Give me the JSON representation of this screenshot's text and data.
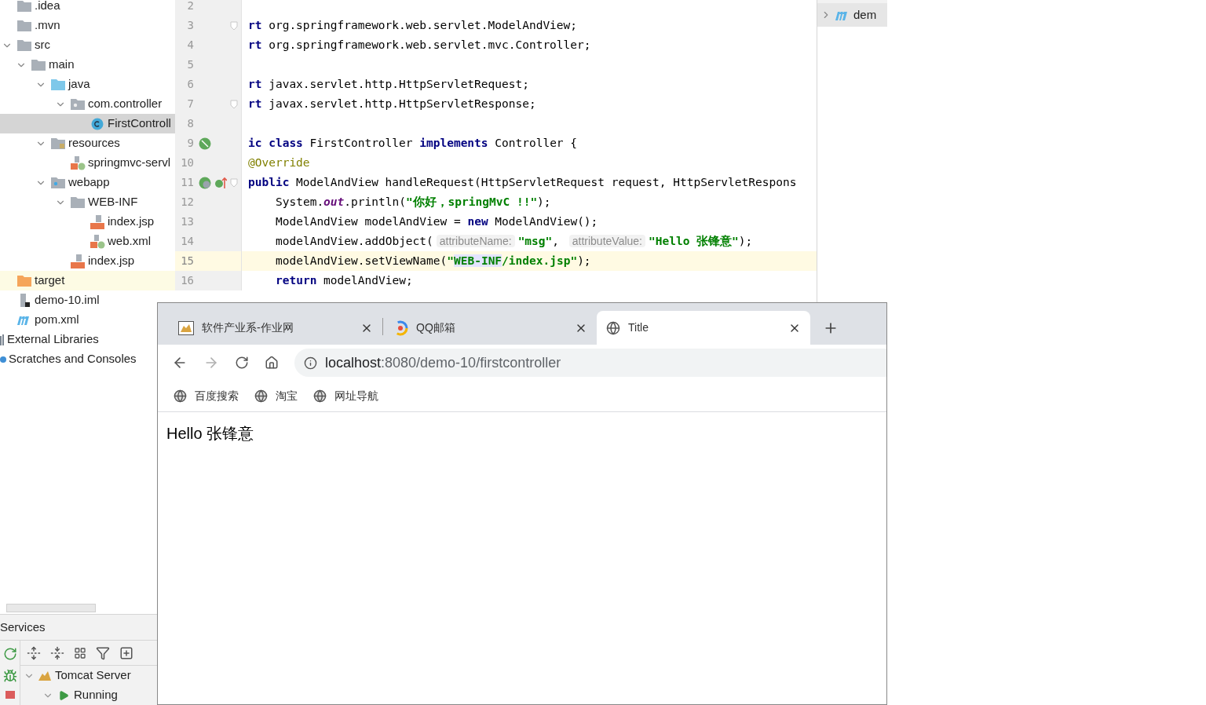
{
  "project_tree": {
    "items": [
      {
        "label": ".idea",
        "kind": "folder",
        "selected": false
      },
      {
        "label": ".mvn",
        "kind": "folder",
        "selected": false
      },
      {
        "label": "src",
        "kind": "folder",
        "selected": false,
        "expanded": true,
        "children": [
          {
            "label": "main",
            "kind": "folder",
            "selected": false,
            "expanded": true,
            "children": [
              {
                "label": "java",
                "kind": "source-folder",
                "selected": false,
                "expanded": true,
                "children": [
                  {
                    "label": "com.controller",
                    "kind": "package",
                    "selected": false,
                    "expanded": true,
                    "children": [
                      {
                        "label": "FirstControll",
                        "kind": "class",
                        "selected": true
                      }
                    ]
                  }
                ]
              },
              {
                "label": "resources",
                "kind": "resources-folder",
                "selected": false,
                "expanded": true,
                "children": [
                  {
                    "label": "springmvc-servl",
                    "kind": "xml",
                    "selected": false
                  }
                ]
              },
              {
                "label": "webapp",
                "kind": "web-folder",
                "selected": false,
                "expanded": true,
                "children": [
                  {
                    "label": "WEB-INF",
                    "kind": "folder",
                    "selected": false,
                    "expanded": true,
                    "children": [
                      {
                        "label": "index.jsp",
                        "kind": "jsp",
                        "selected": false
                      },
                      {
                        "label": "web.xml",
                        "kind": "xml",
                        "selected": false
                      }
                    ]
                  },
                  {
                    "label": "index.jsp",
                    "kind": "jsp",
                    "selected": false
                  }
                ]
              }
            ]
          }
        ]
      },
      {
        "label": "target",
        "kind": "excluded-folder",
        "selected": false
      },
      {
        "label": "demo-10.iml",
        "kind": "iml",
        "selected": false
      },
      {
        "label": "pom.xml",
        "kind": "maven",
        "selected": false
      }
    ],
    "roots": [
      {
        "label": "External Libraries",
        "kind": "libraries"
      },
      {
        "label": "Scratches and Consoles",
        "kind": "scratches"
      }
    ]
  },
  "editor": {
    "lines": [
      {
        "number": "2",
        "selected": false
      },
      {
        "number": "3",
        "selected": false,
        "fold": true,
        "segments": [
          {
            "kind": "keyword",
            "text": "rt"
          },
          {
            "kind": "plain",
            "text": " org.springframework.web.servlet.ModelAndView;"
          }
        ]
      },
      {
        "number": "4",
        "selected": false,
        "segments": [
          {
            "kind": "keyword",
            "text": "rt"
          },
          {
            "kind": "plain",
            "text": " org.springframework.web.servlet.mvc.Controller;"
          }
        ]
      },
      {
        "number": "5",
        "selected": false
      },
      {
        "number": "6",
        "selected": false,
        "segments": [
          {
            "kind": "keyword",
            "text": "rt"
          },
          {
            "kind": "plain",
            "text": " javax.servlet.http.HttpServletRequest;"
          }
        ]
      },
      {
        "number": "7",
        "selected": false,
        "fold": true,
        "segments": [
          {
            "kind": "keyword",
            "text": "rt"
          },
          {
            "kind": "plain",
            "text": " javax.servlet.http.HttpServletResponse;"
          }
        ]
      },
      {
        "number": "8",
        "selected": false
      },
      {
        "number": "9",
        "selected": false,
        "markers": [
          {
            "kind": "bean"
          }
        ],
        "segments": [
          {
            "kind": "keyword",
            "text": "ic class"
          },
          {
            "kind": "plain",
            "text": " FirstController "
          },
          {
            "kind": "keyword",
            "text": "implements"
          },
          {
            "kind": "plain",
            "text": " Controller {"
          }
        ]
      },
      {
        "number": "10",
        "selected": false,
        "segments": [
          {
            "kind": "annotation",
            "text": "@Override"
          }
        ]
      },
      {
        "number": "11",
        "selected": false,
        "fold": true,
        "markers": [
          {
            "kind": "web"
          },
          {
            "kind": "override"
          }
        ],
        "segments": [
          {
            "kind": "keyword",
            "text": "public"
          },
          {
            "kind": "plain",
            "text": " ModelAndView handleRequest(HttpServletRequest request, HttpServletRespons"
          }
        ]
      },
      {
        "number": "12",
        "selected": false,
        "indented": true,
        "segments": [
          {
            "kind": "plain",
            "text": "System."
          },
          {
            "kind": "field",
            "text": "out"
          },
          {
            "kind": "plain",
            "text": ".println("
          },
          {
            "kind": "string",
            "text": "\"你好，springMvC !!\""
          },
          {
            "kind": "plain",
            "text": ");"
          }
        ]
      },
      {
        "number": "13",
        "selected": false,
        "indented": true,
        "segments": [
          {
            "kind": "plain",
            "text": "ModelAndView modelAndView = "
          },
          {
            "kind": "keyword",
            "text": "new"
          },
          {
            "kind": "plain",
            "text": " ModelAndView();"
          }
        ]
      },
      {
        "number": "14",
        "selected": false,
        "indented": true,
        "segments": [
          {
            "kind": "plain",
            "text": "modelAndView.addObject("
          },
          {
            "kind": "hint",
            "text": "attributeName:"
          },
          {
            "kind": "string",
            "text": "\"msg\""
          },
          {
            "kind": "plain",
            "text": ", "
          },
          {
            "kind": "hint",
            "text": "attributeValue:"
          },
          {
            "kind": "string",
            "text": "\"Hello 张锋意\""
          },
          {
            "kind": "plain",
            "text": ");"
          }
        ]
      },
      {
        "number": "15",
        "selected": true,
        "indented": true,
        "segments": [
          {
            "kind": "plain",
            "text": "modelAndView.setViewName("
          },
          {
            "kind": "string",
            "text": "\""
          },
          {
            "kind": "match",
            "text": "WEB-INF"
          },
          {
            "kind": "string",
            "text": "/index.jsp\""
          },
          {
            "kind": "plain",
            "text": ");"
          }
        ]
      },
      {
        "number": "16",
        "selected": false,
        "indented": true,
        "segments": [
          {
            "kind": "keyword",
            "text": "return"
          },
          {
            "kind": "plain",
            "text": " modelAndView;"
          }
        ]
      }
    ]
  },
  "structure_panel": {
    "item": "dem",
    "expanded": false
  },
  "services": {
    "title": "Services",
    "tree": [
      {
        "label": "Tomcat Server",
        "kind": "tomcat",
        "expanded": true,
        "children": [
          {
            "label": "Running",
            "kind": "running",
            "expanded": true
          }
        ]
      }
    ]
  },
  "browser": {
    "tabs": [
      {
        "title": "软件产业系-作业网",
        "kind": "tomcat",
        "selected": false
      },
      {
        "title": "QQ邮箱",
        "kind": "qq",
        "selected": false
      },
      {
        "title": "Title",
        "kind": "globe",
        "selected": true
      }
    ],
    "nav": [
      {
        "kind": "back",
        "disabled": false
      },
      {
        "kind": "forward",
        "disabled": true
      },
      {
        "kind": "reload",
        "disabled": false
      },
      {
        "kind": "home",
        "disabled": false
      }
    ],
    "address": {
      "host": "localhost",
      "rest": ":8080/demo-10/firstcontroller"
    },
    "bookmarks": [
      "百度搜索",
      "淘宝",
      "网址导航"
    ],
    "page": {
      "text": "Hello 张锋意"
    }
  }
}
